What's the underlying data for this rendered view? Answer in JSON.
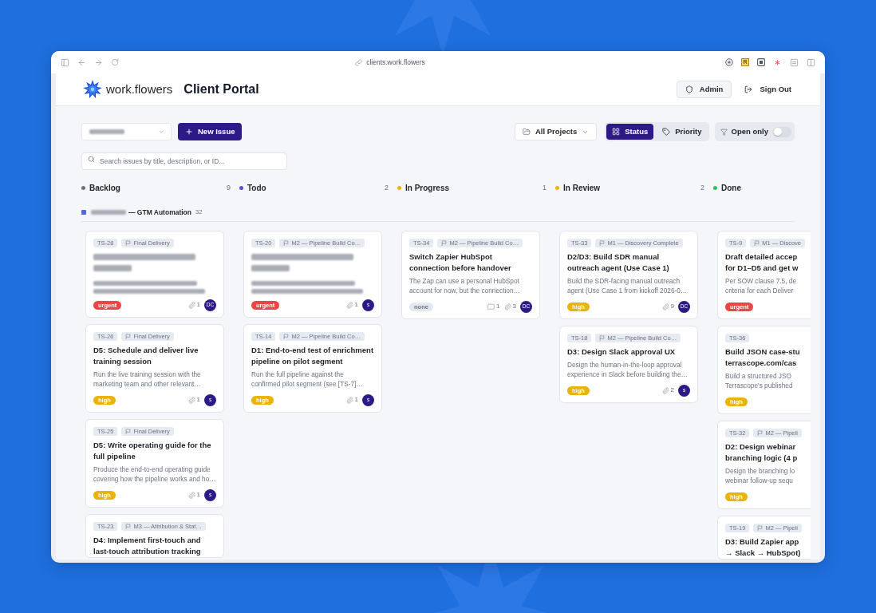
{
  "browser": {
    "url": "clients.work.flowers",
    "extension_letter": "R"
  },
  "header": {
    "brand": "work.flowers",
    "title": "Client Portal",
    "buttons": [
      {
        "kind": "admin",
        "label": "Admin"
      },
      {
        "kind": "signout",
        "label": "Sign Out"
      }
    ]
  },
  "toolbar": {
    "workspace_select": {
      "redacted": true
    },
    "new_button": "New Issue",
    "project_filter": "All Projects",
    "view_tabs": [
      {
        "label": "Status",
        "selected": true
      },
      {
        "label": "Priority",
        "selected": false
      }
    ],
    "open_only": {
      "label": "Open only",
      "on": false
    }
  },
  "search": {
    "placeholder": "Search issues by title, description, or ID..."
  },
  "columns": [
    {
      "name": "Backlog",
      "count": "9",
      "color": "#6b7280"
    },
    {
      "name": "Todo",
      "count": "2",
      "color": "#5b4fc9"
    },
    {
      "name": "In Progress",
      "count": "1",
      "color": "#eab308"
    },
    {
      "name": "In Review",
      "count": "2",
      "color": "#eab308"
    },
    {
      "name": "Done",
      "color": "#22c55e"
    }
  ],
  "project": {
    "name_redacted": true,
    "name": "— GTM Automation",
    "count": "32",
    "lanes": [
      {
        "clipped": false,
        "cards": [
          {
            "id": "TS-28",
            "milestone": "Final Delivery",
            "redacted": true,
            "priority": {
              "kind": "urgent",
              "label": "urgent"
            },
            "attachments": "1",
            "assignee": "DC"
          },
          {
            "id": "TS-26",
            "milestone": "Final Delivery",
            "redacted": false,
            "title": "D5: Schedule and deliver live training session",
            "description": "Run the live training session with the marketing team and other relevant…",
            "priority": {
              "kind": "high",
              "label": "high"
            },
            "attachments": "1",
            "assignee": "s"
          },
          {
            "id": "TS-25",
            "milestone": "Final Delivery",
            "redacted": false,
            "title": "D5: Write operating guide for the full pipeline",
            "description": "Produce the end-to-end operating guide covering how the pipeline works and ho…",
            "priority": {
              "kind": "high",
              "label": "high"
            },
            "attachments": "1",
            "assignee": "s"
          },
          {
            "id": "TS-23",
            "milestone": "M3 — Attribution & Stat…",
            "redacted": false,
            "title": "D4: Implement first-touch and last-touch attribution tracking"
          }
        ]
      },
      {
        "clipped": false,
        "cards": [
          {
            "id": "TS-20",
            "milestone": "M2 — Pipeline Build Co…",
            "redacted": true,
            "priority": {
              "kind": "urgent",
              "label": "urgent"
            },
            "attachments": "1",
            "assignee": "s"
          },
          {
            "id": "TS-14",
            "milestone": "M2 — Pipeline Build Co…",
            "redacted": false,
            "title": "D1: End-to-end test of enrichment pipeline on pilot segment",
            "description": "Run the full pipeline against the confirmed pilot segment (see [TS-7]…",
            "priority": {
              "kind": "high",
              "label": "high"
            },
            "attachments": "1",
            "assignee": "s"
          }
        ]
      },
      {
        "clipped": false,
        "cards": [
          {
            "id": "TS-34",
            "milestone": "M2 — Pipeline Build Co…",
            "redacted": false,
            "title": "Switch Zapier HubSpot connection before handover",
            "description": "The Zap can use a personal HubSpot account for now, but the connection…",
            "priority": {
              "kind": "none",
              "label": "none"
            },
            "comments": "1",
            "attachments": "3",
            "assignee": "DC"
          }
        ]
      },
      {
        "clipped": false,
        "cards": [
          {
            "id": "TS-33",
            "milestone": "M1 — Discovery Complete",
            "redacted": false,
            "title": "D2/D3: Build SDR manual outreach agent (Use Case 1)",
            "description": "Build the SDR-facing manual outreach agent (Use Case 1 from kickoff 2026-0…",
            "priority": {
              "kind": "high",
              "label": "high"
            },
            "attachments": "9",
            "assignee": "DC"
          },
          {
            "id": "TS-18",
            "milestone": "M2 — Pipeline Build Co…",
            "redacted": false,
            "title": "D3: Design Slack approval UX",
            "description": "Design the human-in-the-loop approval experience in Slack before building the…",
            "priority": {
              "kind": "high",
              "label": "high"
            },
            "attachments": "2",
            "assignee": "s"
          }
        ]
      },
      {
        "clipped": true,
        "cards": [
          {
            "id": "TS-9",
            "milestone": "M1 — Discove",
            "redacted": false,
            "title": "Draft detailed accep\nfor D1–D5 and get w",
            "description": "Per SOW clause 7.5, de\ncriteria for each Deliver",
            "priority": {
              "kind": "urgent",
              "label": "urgent"
            }
          },
          {
            "id": "TS-36",
            "redacted": false,
            "title": "Build JSON case-stu\nterrascope.com/cas",
            "description": "Build a structured JSO\nTerrascope's published",
            "priority": {
              "kind": "high",
              "label": "high"
            }
          },
          {
            "id": "TS-32",
            "milestone": "M2 — Pipeli",
            "redacted": false,
            "title": "D2: Design webinar\nbranching logic (4 p",
            "description": "Design the branching lo\nwebinar follow-up sequ",
            "priority": {
              "kind": "high",
              "label": "high"
            }
          },
          {
            "id": "TS-19",
            "milestone": "M2 — Pipeli",
            "redacted": false,
            "title": "D3: Build Zapier app\n→ Slack → HubSpot)"
          }
        ]
      }
    ]
  }
}
